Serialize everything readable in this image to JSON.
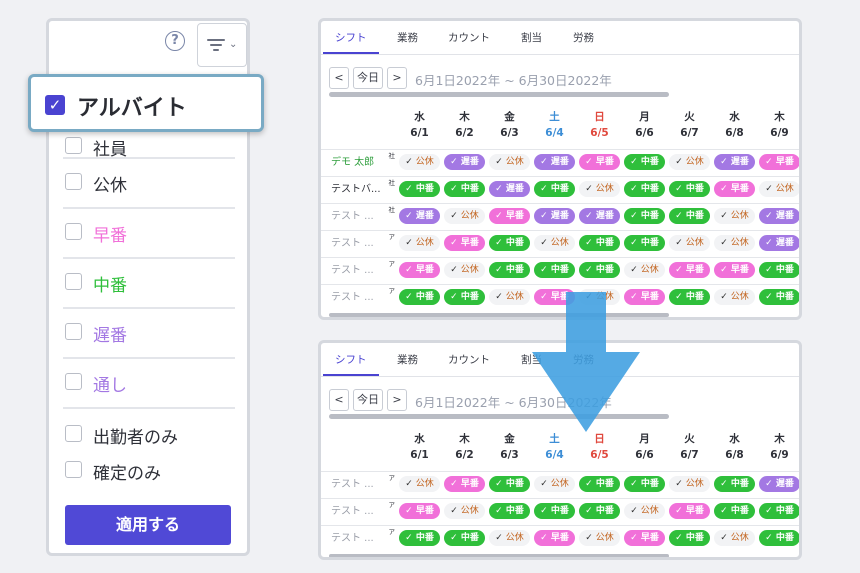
{
  "filter": {
    "help_icon": "?",
    "items": [
      {
        "label": "社員",
        "color": "#2e3038"
      },
      {
        "label": "公休",
        "color": "#2e3038"
      },
      {
        "label": "早番",
        "color": "#f170d9"
      },
      {
        "label": "中番",
        "color": "#2fbf3b"
      },
      {
        "label": "遅番",
        "color": "#a378e3"
      },
      {
        "label": "通し",
        "color": "#a378e3"
      }
    ],
    "extra": [
      {
        "label": "出勤者のみ"
      },
      {
        "label": "確定のみ"
      }
    ],
    "apply_label": "適用する",
    "callout": {
      "label": "アルバイト",
      "checked": true
    }
  },
  "tabs": [
    "シフト",
    "業務",
    "カウント",
    "割当",
    "労務"
  ],
  "nav": {
    "prev": "<",
    "today": "今日",
    "next": ">",
    "range": "6月1日2022年 ~ 6月30日2022年"
  },
  "days": [
    {
      "wd": "水",
      "d": "6/1",
      "kind": ""
    },
    {
      "wd": "木",
      "d": "6/2",
      "kind": ""
    },
    {
      "wd": "金",
      "d": "6/3",
      "kind": ""
    },
    {
      "wd": "土",
      "d": "6/4",
      "kind": "sat"
    },
    {
      "wd": "日",
      "d": "6/5",
      "kind": "sun"
    },
    {
      "wd": "月",
      "d": "6/6",
      "kind": ""
    },
    {
      "wd": "火",
      "d": "6/7",
      "kind": ""
    },
    {
      "wd": "水",
      "d": "6/8",
      "kind": ""
    },
    {
      "wd": "木",
      "d": "6/9",
      "kind": ""
    }
  ],
  "shift_labels": {
    "naka": "中番",
    "oso": "遅番",
    "haya": "早番",
    "kou": "公休"
  },
  "top_rows": [
    {
      "name": "デモ 太郎",
      "tag": "社",
      "style": "primary",
      "cells": [
        "kou",
        "oso",
        "kou",
        "oso",
        "haya",
        "naka",
        "kou",
        "oso",
        "haya"
      ]
    },
    {
      "name": "テストバ...",
      "tag": "社",
      "style": "dark",
      "cells": [
        "naka",
        "naka",
        "oso",
        "naka",
        "kou",
        "naka",
        "naka",
        "haya",
        "kou"
      ]
    },
    {
      "name": "テスト ...",
      "tag": "社",
      "style": "",
      "cells": [
        "oso",
        "kou",
        "haya",
        "oso",
        "oso",
        "naka",
        "naka",
        "kou",
        "oso"
      ]
    },
    {
      "name": "テスト ...",
      "tag": "ア",
      "style": "",
      "cells": [
        "kou",
        "haya",
        "naka",
        "kou",
        "naka",
        "naka",
        "kou",
        "kou",
        "oso"
      ]
    },
    {
      "name": "テスト ...",
      "tag": "ア",
      "style": "",
      "cells": [
        "haya",
        "kou",
        "naka",
        "naka",
        "naka",
        "kou",
        "haya",
        "haya",
        "naka"
      ]
    },
    {
      "name": "テスト ...",
      "tag": "ア",
      "style": "",
      "cells": [
        "naka",
        "naka",
        "kou",
        "haya",
        "kou",
        "haya",
        "naka",
        "kou",
        "naka"
      ]
    }
  ],
  "bottom_rows": [
    {
      "name": "テスト ...",
      "tag": "ア",
      "style": "",
      "cells": [
        "kou",
        "haya",
        "naka",
        "kou",
        "naka",
        "naka",
        "kou",
        "naka",
        "oso"
      ]
    },
    {
      "name": "テスト ...",
      "tag": "ア",
      "style": "",
      "cells": [
        "haya",
        "kou",
        "naka",
        "naka",
        "naka",
        "kou",
        "haya",
        "naka",
        "naka"
      ]
    },
    {
      "name": "テスト ...",
      "tag": "ア",
      "style": "",
      "cells": [
        "naka",
        "naka",
        "kou",
        "haya",
        "kou",
        "haya",
        "naka",
        "kou",
        "naka"
      ]
    }
  ],
  "colors": {
    "accent": "#4a43d1",
    "arrow": "#3e9ee0"
  }
}
